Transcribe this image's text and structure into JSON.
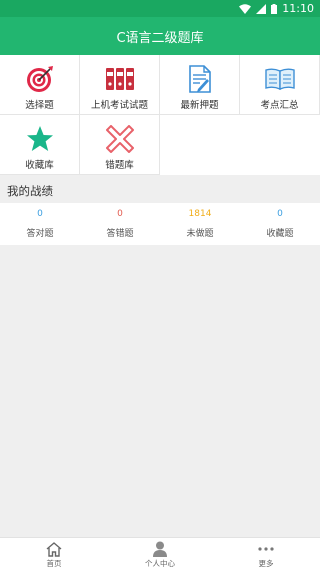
{
  "status_bar": {
    "time": "11:10"
  },
  "app_bar": {
    "title": "C语言二级题库"
  },
  "grid": {
    "items": [
      {
        "label": "选择题",
        "icon": "target-icon"
      },
      {
        "label": "上机考试试题",
        "icon": "binders-icon"
      },
      {
        "label": "最新押题",
        "icon": "edit-document-icon"
      },
      {
        "label": "考点汇总",
        "icon": "open-book-icon"
      },
      {
        "label": "收藏库",
        "icon": "star-icon"
      },
      {
        "label": "错题库",
        "icon": "cross-icon"
      }
    ]
  },
  "record": {
    "title": "我的战绩",
    "stats": [
      {
        "value": "0",
        "label": "答对题",
        "color": "#3a9ee0"
      },
      {
        "value": "0",
        "label": "答错题",
        "color": "#e25a4e"
      },
      {
        "value": "1814",
        "label": "未做题",
        "color": "#f0ad1a"
      },
      {
        "value": "0",
        "label": "收藏题",
        "color": "#3a9ee0"
      }
    ]
  },
  "bottom_nav": {
    "items": [
      {
        "label": "首页",
        "icon": "home-icon"
      },
      {
        "label": "个人中心",
        "icon": "person-icon"
      },
      {
        "label": "更多",
        "icon": "more-dots-icon"
      }
    ]
  },
  "colors": {
    "brand": "#22b670",
    "status_bar": "#1aa861"
  }
}
